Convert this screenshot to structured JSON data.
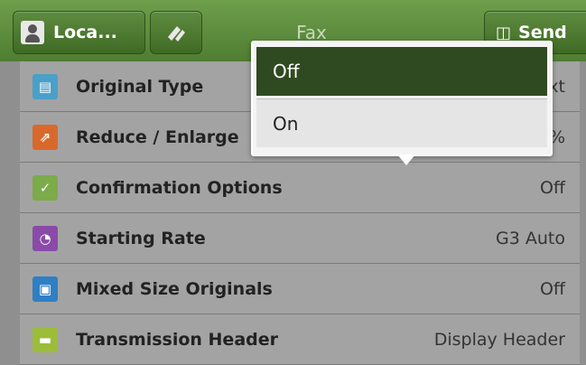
{
  "header": {
    "local_label": "Loca...",
    "title": "Fax",
    "send_label": "Send"
  },
  "dropdown": {
    "options": [
      "Off",
      "On"
    ],
    "selected": "Off"
  },
  "settings": [
    {
      "label": "Original Type",
      "value": "xt",
      "icon": "original-type-icon",
      "color": "#4aa0c8"
    },
    {
      "label": "Reduce / Enlarge",
      "value": "%",
      "icon": "reduce-enlarge-icon",
      "color": "#d9692b"
    },
    {
      "label": "Confirmation Options",
      "value": "Off",
      "icon": "confirmation-options-icon",
      "color": "#7cab4a"
    },
    {
      "label": "Starting Rate",
      "value": "G3 Auto",
      "icon": "starting-rate-icon",
      "color": "#8a4aa8"
    },
    {
      "label": "Mixed Size Originals",
      "value": "Off",
      "icon": "mixed-size-originals-icon",
      "color": "#2f7fc4"
    },
    {
      "label": "Transmission Header",
      "value": "Display Header",
      "icon": "transmission-header-icon",
      "color": "#9cbd3a"
    }
  ]
}
